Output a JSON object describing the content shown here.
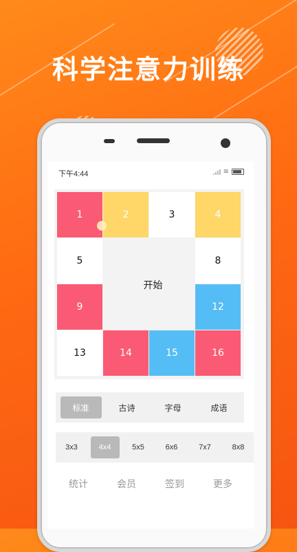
{
  "hero": {
    "title": "科学注意力训练"
  },
  "status": {
    "time": "下午4:44"
  },
  "board": {
    "cells": [
      {
        "label": "1",
        "color": "pink"
      },
      {
        "label": "2",
        "color": "yellow"
      },
      {
        "label": "3",
        "color": "white"
      },
      {
        "label": "4",
        "color": "yellow"
      },
      {
        "label": "5",
        "color": "white"
      },
      {
        "label": "8",
        "color": "white"
      },
      {
        "label": "9",
        "color": "pink"
      },
      {
        "label": "12",
        "color": "blue"
      },
      {
        "label": "13",
        "color": "white"
      },
      {
        "label": "14",
        "color": "pink"
      },
      {
        "label": "15",
        "color": "blue"
      },
      {
        "label": "16",
        "color": "pink"
      }
    ],
    "start_label": "开始"
  },
  "modes": {
    "items": [
      "标准",
      "古诗",
      "字母",
      "成语"
    ],
    "selected": "标准"
  },
  "sizes": {
    "items": [
      "3x3",
      "4x4",
      "5x5",
      "6x6",
      "7x7",
      "8x8"
    ],
    "selected": "4x4"
  },
  "nav": {
    "items": [
      "统计",
      "会员",
      "签到",
      "更多"
    ]
  },
  "colors": {
    "pink": "#fb5a74",
    "yellow": "#ffd668",
    "blue": "#55bdf5",
    "accent": "#ff6a12"
  }
}
